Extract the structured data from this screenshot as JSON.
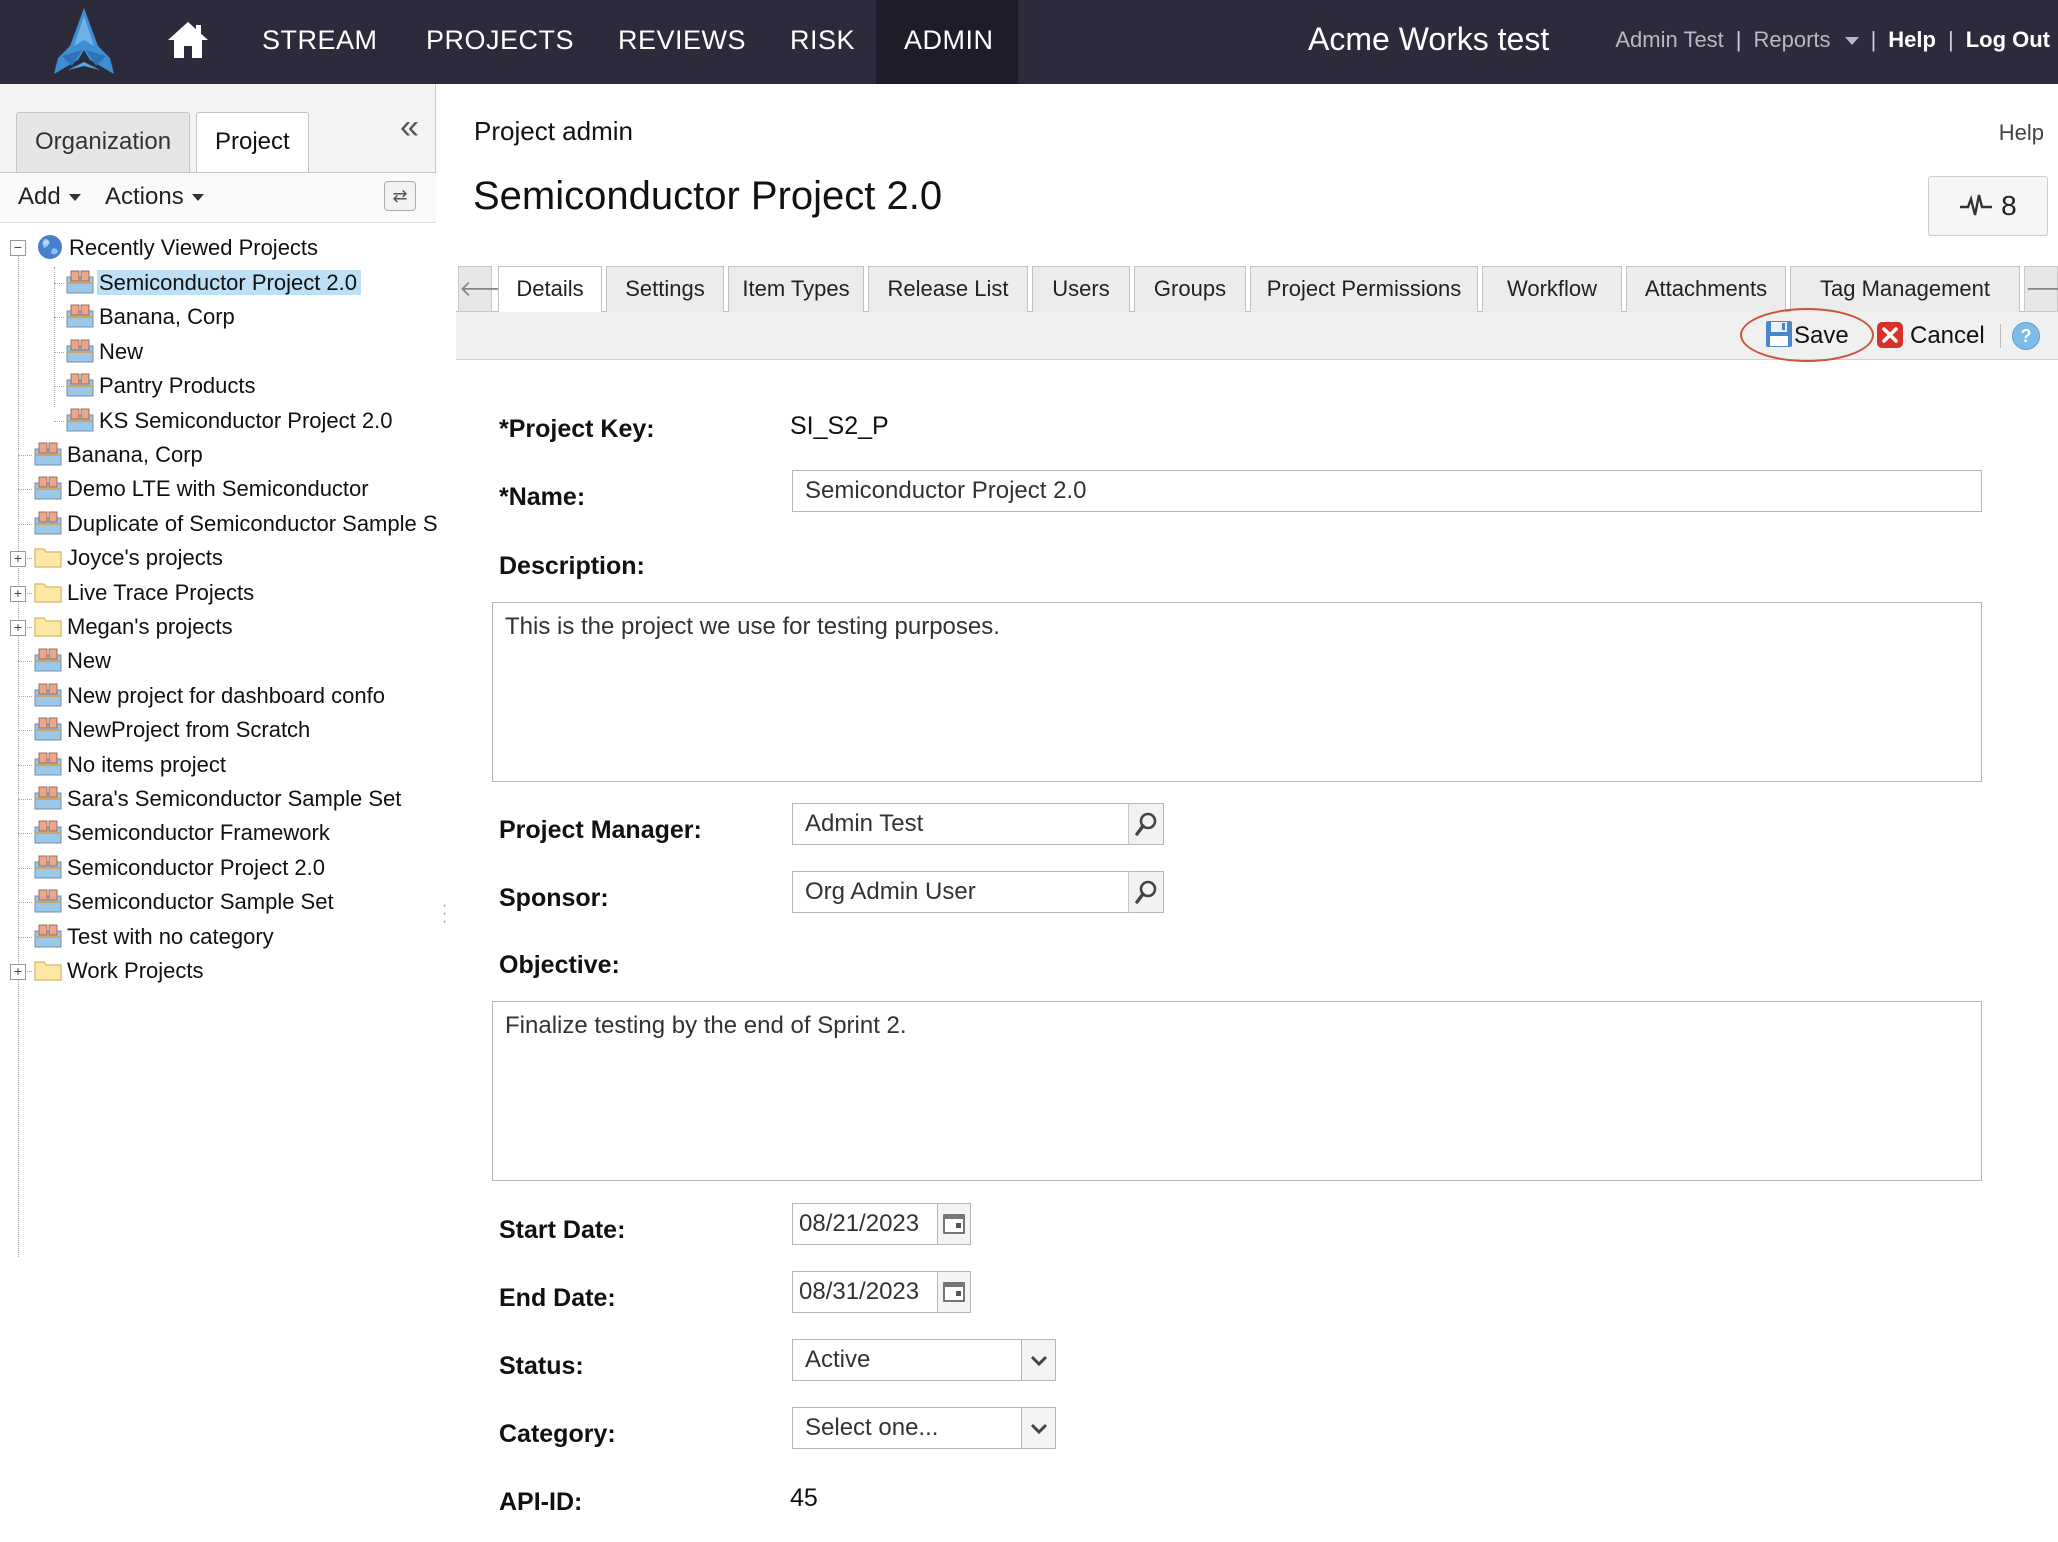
{
  "topbar": {
    "nav": [
      "STREAM",
      "PROJECTS",
      "REVIEWS",
      "RISK",
      "ADMIN"
    ],
    "active_nav": "ADMIN",
    "org_title": "Acme Works test",
    "user": "Admin Test",
    "reports": "Reports",
    "help": "Help",
    "logout": "Log Out"
  },
  "left": {
    "tabs": [
      "Organization",
      "Project"
    ],
    "active_tab": "Project",
    "toolbar": {
      "add": "Add",
      "actions": "Actions"
    },
    "tree": {
      "recent_label": "Recently Viewed Projects",
      "recent": [
        "Semiconductor Project 2.0",
        "Banana, Corp",
        "New",
        "Pantry Products",
        "KS Semiconductor Project 2.0"
      ],
      "items": [
        {
          "label": "Banana, Corp",
          "type": "project"
        },
        {
          "label": "Demo LTE with Semiconductor",
          "type": "project"
        },
        {
          "label": "Duplicate of Semiconductor Sample S",
          "type": "project"
        },
        {
          "label": "Joyce's projects",
          "type": "folder"
        },
        {
          "label": "Live Trace Projects",
          "type": "folder"
        },
        {
          "label": "Megan's projects",
          "type": "folder"
        },
        {
          "label": "New",
          "type": "project"
        },
        {
          "label": "New project for dashboard confo",
          "type": "project"
        },
        {
          "label": "NewProject from Scratch",
          "type": "project"
        },
        {
          "label": "No items project",
          "type": "project"
        },
        {
          "label": "Sara's Semiconductor Sample Set",
          "type": "project"
        },
        {
          "label": "Semiconductor Framework",
          "type": "project"
        },
        {
          "label": "Semiconductor Project 2.0",
          "type": "project"
        },
        {
          "label": "Semiconductor Sample Set",
          "type": "project"
        },
        {
          "label": "Test with no category",
          "type": "project"
        },
        {
          "label": "Work Projects",
          "type": "folder"
        }
      ]
    }
  },
  "main": {
    "breadcrumb": "Project admin",
    "help": "Help",
    "title": "Semiconductor Project 2.0",
    "activity_count": "8",
    "tabs": [
      "Details",
      "Settings",
      "Item Types",
      "Release List",
      "Users",
      "Groups",
      "Project Permissions",
      "Workflow",
      "Attachments",
      "Tag Management"
    ],
    "active_tab": "Details",
    "actions": {
      "save": "Save",
      "cancel": "Cancel"
    },
    "form": {
      "project_key_label": "*Project Key:",
      "project_key": "SI_S2_P",
      "name_label": "*Name:",
      "name": "Semiconductor Project 2.0",
      "description_label": "Description:",
      "description": "This is the project we use for testing purposes.",
      "manager_label": "Project Manager:",
      "manager": "Admin Test",
      "sponsor_label": "Sponsor:",
      "sponsor": "Org Admin User",
      "objective_label": "Objective:",
      "objective": "Finalize testing by the end of Sprint 2.",
      "start_label": "Start Date:",
      "start_date": "08/21/2023",
      "end_label": "End Date:",
      "end_date": "08/31/2023",
      "status_label": "Status:",
      "status": "Active",
      "category_label": "Category:",
      "category": "Select one...",
      "api_label": "API-ID:",
      "api_id": "45"
    }
  },
  "colors": {
    "topbar": "#2b2b3b",
    "topbar_active": "#1d1d2a",
    "selected_node": "#bde0f6",
    "save_highlight": "#c8553d",
    "logo": "#3f8fd2"
  }
}
